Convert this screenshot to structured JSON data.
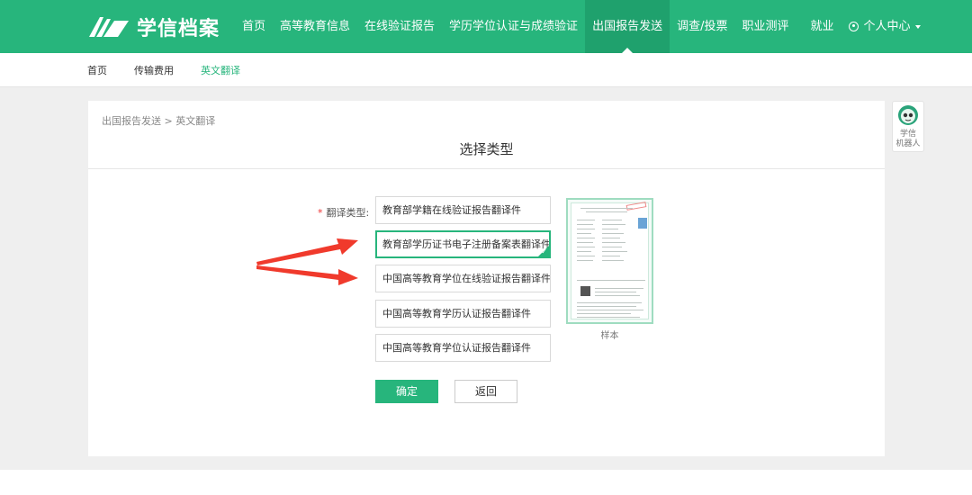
{
  "header": {
    "brand": "学信档案",
    "nav": [
      "首页",
      "高等教育信息",
      "在线验证报告",
      "学历学位认证与成绩验证",
      "出国报告发送",
      "调查/投票",
      "职业测评",
      "就业"
    ],
    "user_center": "个人中心",
    "accent_color": "#27b57c"
  },
  "subnav": {
    "items": [
      "首页",
      "传输费用",
      "英文翻译"
    ],
    "active": "英文翻译"
  },
  "main": {
    "breadcrumb": "出国报告发送 > 英文翻译",
    "title": "选择类型",
    "required_mark": "*",
    "field_label": "翻译类型:",
    "options": [
      "教育部学籍在线验证报告翻译件",
      "教育部学历证书电子注册备案表翻译件",
      "中国高等教育学位在线验证报告翻译件",
      "中国高等教育学历认证报告翻译件",
      "中国高等教育学位认证报告翻译件"
    ],
    "selected_index": 1,
    "confirm_button": "确定",
    "back_button": "返回",
    "sample_caption": "样本"
  },
  "robot": {
    "label_line1": "学信",
    "label_line2": "机器人"
  },
  "annotation": {
    "arrow_color": "#f03a2c"
  }
}
